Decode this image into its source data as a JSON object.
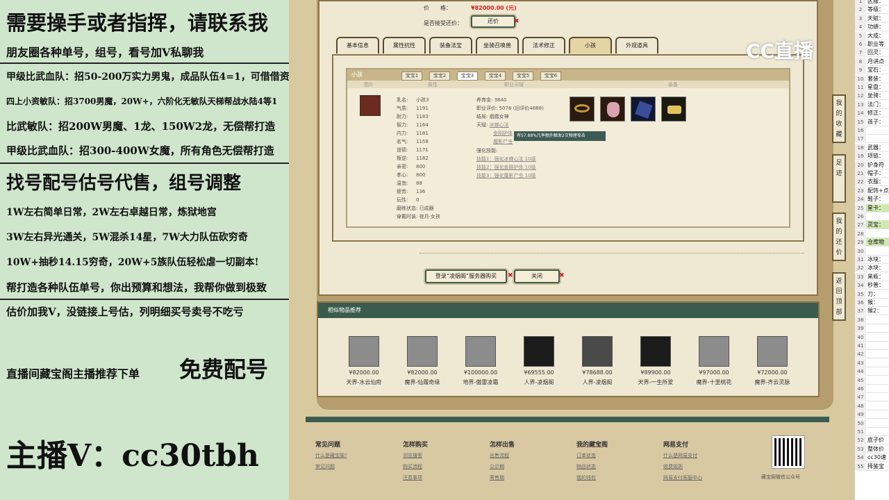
{
  "promo": {
    "lines": [
      "需要操手或者指挥，请联系我",
      "朋友圈各种单号，组号，看号加V私聊我",
      "甲级比武血队：招50-200万实力男鬼，成品队伍4=1，可借借资资",
      "四上小资敏队：招3700男魔，20W+，六阶化无敏队天梯帮战水陆4等1",
      "比武敏队：招200W男魔、1龙、150W2龙，无偿帮打造",
      "甲级比武血队：招300-400W女魔，所有角色无偿帮打造",
      "找号配号估号代售，组号调整",
      "1W左右简单日常，2W左右卓越日常，炼狱地宫",
      "3W左右异光通关，5W混杀14星，7W大力队伍砍穷奇",
      "10W+抽秒14.15穷奇，20W+5族队伍轻松虐一切副本!",
      "帮打造各种队伍单号，你出预算和想法，我帮你做到极致",
      "估价加我V，没链接上号估，列明细买号卖号不吃亏",
      "直播间藏宝阁主播推荐下单",
      "免费配号",
      "主播V：cc30tbh"
    ]
  },
  "watermark": "CC直播",
  "price": {
    "label": "价　　格：",
    "value": "¥82000.00 (元)",
    "counter_label": "是否接受还价：",
    "counter_button": "还价"
  },
  "tabs": [
    "基本信息",
    "属性抗性",
    "装备法宝",
    "坐骑召唤兽",
    "法术修正",
    "小孩",
    "外观道具"
  ],
  "active_tab": "小孩",
  "child": {
    "section_title": "小孩",
    "treasure_tabs": [
      "宝宝1",
      "宝宝2",
      "宝宝3",
      "宝宝4",
      "宝宝5",
      "宝宝6"
    ],
    "columns": [
      "图片",
      "属性",
      "职业天赋",
      "装备"
    ],
    "stats": [
      [
        "乳名:",
        "小孩3"
      ],
      [
        "气质:",
        "1191"
      ],
      [
        "耐力:",
        "1183"
      ],
      [
        "智力:",
        "1164"
      ],
      [
        "内力:",
        "1181"
      ],
      [
        "名气:",
        "1158"
      ],
      [
        "道德:",
        "1171"
      ],
      [
        "叛逆:",
        "1182"
      ],
      [
        "亲密:",
        "800"
      ],
      [
        "孝心:",
        "800"
      ],
      [
        "温饱:",
        "88"
      ],
      [
        "疲劳:",
        "136"
      ],
      [
        "玩性:",
        "0"
      ],
      [
        "磨练状态:",
        "已成器"
      ],
      [
        "穿戴时装:",
        "夜月·女孩"
      ]
    ],
    "career": [
      [
        "养育金:",
        "3840"
      ],
      [
        "职业评价:",
        "5078 (旧评价4888)"
      ],
      [
        "结局:",
        "烟霞女神"
      ],
      [
        "天赋:",
        "冰蝉心法"
      ]
    ],
    "talent_links": [
      "金刚护体",
      "魔影尸虫"
    ],
    "tooltip": "有57.88%几率额外触发2次物理攻击",
    "skills_label": "强化技能:",
    "skills": [
      "技能1：强化冰蝉心法 10级",
      "技能2：强化金刚护体 10级",
      "技能3：强化魔影尸虫 10级"
    ]
  },
  "buttons": {
    "login": "登录“凌烟阁”服务器购买",
    "close": "关闭"
  },
  "similar": {
    "title": "相似物品推荐",
    "items": [
      {
        "price": "¥82000.00",
        "name": "天界-水云仙府"
      },
      {
        "price": "¥82000.00",
        "name": "魔界-仙履奇缘"
      },
      {
        "price": "¥100000.00",
        "name": "地界-傲雷凌霜"
      },
      {
        "price": "¥69555.00",
        "name": "人界-凌烟阁"
      },
      {
        "price": "¥78688.00",
        "name": "人界-凌烟阁"
      },
      {
        "price": "¥89900.00",
        "name": "天界-一生所爱"
      },
      {
        "price": "¥97000.00",
        "name": "魔界-十里桃花"
      },
      {
        "price": "¥72000.00",
        "name": "魔界-齐云灵脉"
      }
    ]
  },
  "side_buttons": [
    "我的收藏",
    "足迹",
    "我的还价",
    "返回顶部"
  ],
  "footer": {
    "cols": [
      {
        "title": "常见问题",
        "links": [
          "什么是藏宝阁?",
          "常见问题"
        ]
      },
      {
        "title": "怎样购买",
        "links": [
          "浏览搜索",
          "购买流程",
          "注意事项"
        ]
      },
      {
        "title": "怎样出售",
        "links": [
          "出售流程",
          "公示期",
          "寄售期"
        ]
      },
      {
        "title": "我的藏宝阁",
        "links": [
          "订单状态",
          "物品状态",
          "我的钱包"
        ]
      },
      {
        "title": "网易支付",
        "links": [
          "什么是网易支付",
          "收费规则",
          "网易支付客服中心"
        ]
      }
    ],
    "qr_caption": "藏宝阁微信公众号"
  },
  "sheet": {
    "rows": [
      [
        "1",
        "区服："
      ],
      [
        "2",
        "等级："
      ],
      [
        "3",
        "天赋："
      ],
      [
        "4",
        "功绩："
      ],
      [
        "5",
        "大成："
      ],
      [
        "6",
        "职业等"
      ],
      [
        "7",
        "回灵："
      ],
      [
        "8",
        "月讲点"
      ],
      [
        "9",
        "宝石："
      ],
      [
        "10",
        "套装："
      ],
      [
        "11",
        "星盘："
      ],
      [
        "12",
        "坐骑："
      ],
      [
        "13",
        "法门："
      ],
      [
        "14",
        "修正："
      ],
      [
        "15",
        "孩子："
      ],
      [
        "16",
        ""
      ],
      [
        "17",
        ""
      ],
      [
        "18",
        "武器："
      ],
      [
        "19",
        "项链："
      ],
      [
        "20",
        "护身符"
      ],
      [
        "21",
        "帽子："
      ],
      [
        "22",
        "衣服："
      ],
      [
        "23",
        "配饰+点"
      ],
      [
        "24",
        "鞋子："
      ],
      [
        "25",
        "星卡："
      ],
      [
        "26",
        ""
      ],
      [
        "27",
        "灵宝："
      ],
      [
        "28",
        ""
      ],
      [
        "29",
        "仓库物"
      ],
      [
        "30",
        ""
      ],
      [
        "31",
        "冰块："
      ],
      [
        "32",
        "冰块："
      ],
      [
        "33",
        "黑瓶："
      ],
      [
        "34",
        "秒普："
      ],
      [
        "35",
        "刀："
      ],
      [
        "36",
        "猴："
      ],
      [
        "37",
        "猴2："
      ],
      [
        "38",
        ""
      ],
      [
        "39",
        ""
      ],
      [
        "40",
        ""
      ],
      [
        "41",
        ""
      ],
      [
        "42",
        ""
      ],
      [
        "43",
        ""
      ],
      [
        "44",
        ""
      ],
      [
        "45",
        ""
      ],
      [
        "46",
        ""
      ],
      [
        "47",
        ""
      ],
      [
        "48",
        ""
      ],
      [
        "49",
        ""
      ],
      [
        "50",
        ""
      ],
      [
        "51",
        ""
      ],
      [
        "52",
        "底子价"
      ],
      [
        "53",
        "整体价"
      ],
      [
        "54",
        "cc30速"
      ],
      [
        "55",
        "择鉴宝"
      ]
    ]
  },
  "colors": {
    "accent_green": "#3b5c4d",
    "price_red": "#d22222",
    "promo_bg": "#cfe6cc"
  }
}
